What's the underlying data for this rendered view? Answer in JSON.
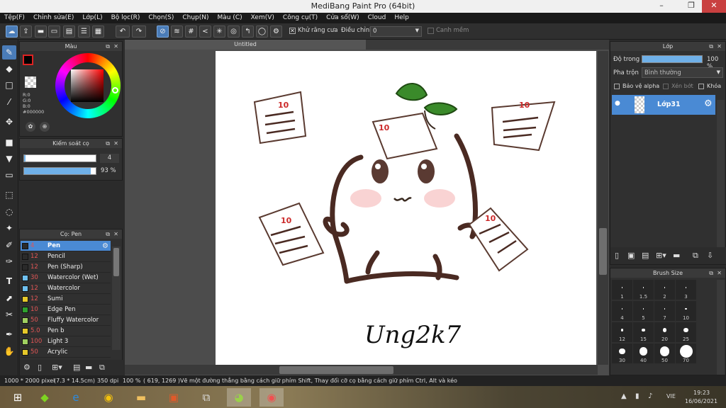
{
  "window": {
    "title": "MediBang Paint Pro (64bit)",
    "minimize_glyph": "–",
    "restore_glyph": "❐",
    "close_glyph": "✕"
  },
  "menu": [
    "Tệp(F)",
    "Chỉnh sửa(E)",
    "Lớp(L)",
    "Bộ lọc(R)",
    "Chọn(S)",
    "Chụp(N)",
    "Màu (C)",
    "Xem(V)",
    "Công cụ(T)",
    "Cửa sổ(W)",
    "Cloud",
    "Help"
  ],
  "toolbar": {
    "antialias_label": "Khử răng cưa",
    "adjust_label": "Điều chỉnh",
    "adjust_value": "0",
    "edge_label": "Canh mềm"
  },
  "color_panel": {
    "title": "Màu",
    "r": "R:0",
    "g": "G:0",
    "b": "B:0",
    "hex": "#000000"
  },
  "brush_control": {
    "title": "Kiểm soát cọ",
    "size_value": "4",
    "opacity_value": "93 %",
    "opacity_fraction": 0.93
  },
  "brush_panel": {
    "title": "Cọ: Pen",
    "items": [
      {
        "size": "4",
        "name": "Pen",
        "color": "#2a2a2a"
      },
      {
        "size": "12",
        "name": "Pencil",
        "color": "#2a2a2a"
      },
      {
        "size": "12",
        "name": "Pen (Sharp)",
        "color": "#2a2a2a"
      },
      {
        "size": "30",
        "name": "Watercolor (Wet)",
        "color": "#6fc0f0"
      },
      {
        "size": "12",
        "name": "Watercolor",
        "color": "#6fc0f0"
      },
      {
        "size": "12",
        "name": "Sumi",
        "color": "#e6c82a"
      },
      {
        "size": "10",
        "name": "Edge Pen",
        "color": "#2fa12f"
      },
      {
        "size": "50",
        "name": "Fluffy Watercolor",
        "color": "#a0d060"
      },
      {
        "size": "5.0",
        "name": "Pen b",
        "color": "#e6c82a"
      },
      {
        "size": "100",
        "name": "Light 3",
        "color": "#a0d060"
      },
      {
        "size": "50",
        "name": "Acrylic",
        "color": "#e6c82a"
      }
    ]
  },
  "canvas": {
    "tab_title": "Untitled",
    "signature": "Ung2k7"
  },
  "layer_panel": {
    "title": "Lớp",
    "opacity_label": "Độ trong",
    "opacity_value": "100 %",
    "blend_label": "Pha trộn",
    "blend_value": "Bình thường",
    "protect_alpha": "Bảo vệ alpha",
    "clipping": "Xén bớt",
    "lock": "Khóa",
    "layer_name": "Lớp31"
  },
  "brush_size_panel": {
    "title": "Brush Size",
    "sizes": [
      "1",
      "1.5",
      "2",
      "3",
      "4",
      "5",
      "7",
      "10",
      "12",
      "15",
      "20",
      "25",
      "30",
      "40",
      "50",
      "70"
    ]
  },
  "status": {
    "canvas_size": "1000 * 2000 pixel",
    "physical_size": "(7.3 * 14.5cm)",
    "dpi": "350 dpi",
    "zoom": "100 %",
    "coords": "( 619, 1269 )",
    "hint": "Vẽ một đường thẳng bằng cách giữ phím Shift, Thay đổi cỡ cọ bằng cách giữ phím Ctrl, Alt và kéo"
  },
  "taskbar": {
    "lang": "VIE",
    "time": "19:23",
    "date": "16/06/2021"
  }
}
